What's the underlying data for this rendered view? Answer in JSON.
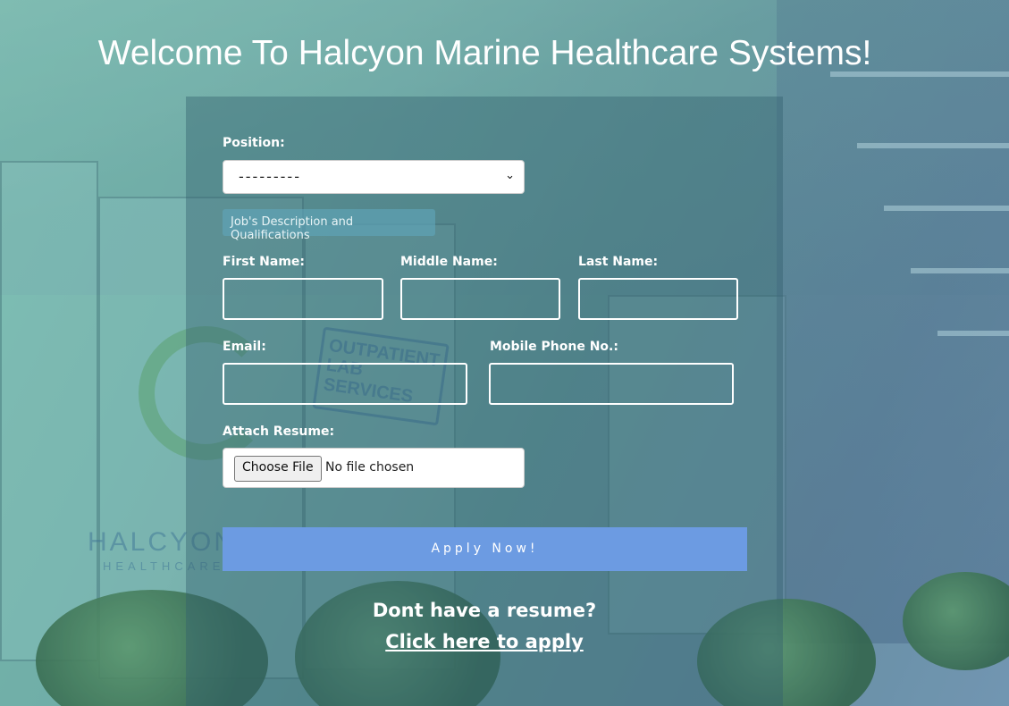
{
  "page": {
    "title": "Welcome To Halcyon Marine Healthcare Systems!"
  },
  "background": {
    "sign_text": "OUTPATIENT LAB SERVICES",
    "logo_wordmark": "HALCYON",
    "logo_subtitle": "HEALTHCARE"
  },
  "form": {
    "position": {
      "label": "Position:",
      "selected_value": "---------"
    },
    "description_button_label": "Job's Description and Qualifications",
    "first_name": {
      "label": "First Name:",
      "value": ""
    },
    "middle_name": {
      "label": "Middle Name:",
      "value": ""
    },
    "last_name": {
      "label": "Last Name:",
      "value": ""
    },
    "email": {
      "label": "Email:",
      "value": ""
    },
    "mobile": {
      "label": "Mobile Phone No.:",
      "value": ""
    },
    "resume": {
      "label": "Attach Resume:",
      "choose_button": "Choose File",
      "status": "No file chosen"
    },
    "apply_button": "Apply Now!"
  },
  "footer": {
    "no_resume_text": "Dont have a resume?",
    "link_text": "Click here to apply"
  },
  "colors": {
    "apply_button": "#6c9be2",
    "card_overlay": "#325f6e",
    "description_button": "#5fa5b9"
  }
}
